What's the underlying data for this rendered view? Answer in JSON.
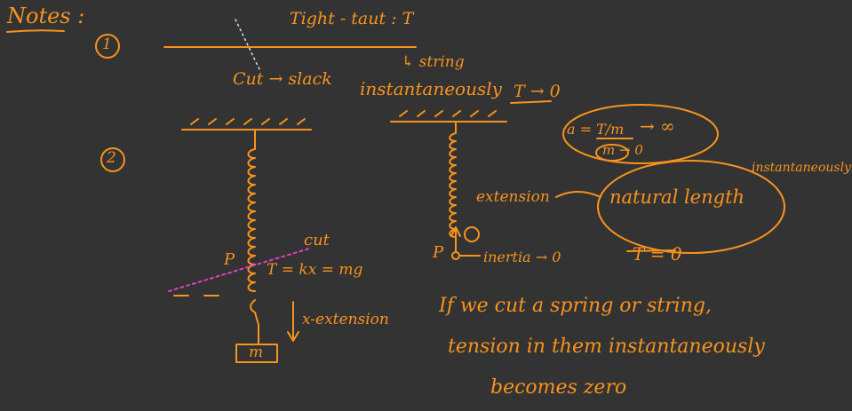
{
  "title": "Notes :",
  "markers": {
    "one": "1",
    "two": "2"
  },
  "part1": {
    "tight_taut": "Tight - taut : T",
    "cut_slack": "Cut → slack",
    "string": "↳ string",
    "instantaneously": "instantaneously",
    "t_to_zero": "T → 0"
  },
  "part2_left": {
    "cut": "cut",
    "point_p": "P",
    "tension_eq": "T = kx = mg",
    "x_extension": "x-extension",
    "mass": "m"
  },
  "part2_right": {
    "point_p": "P",
    "inertia": "inertia → 0",
    "extension": "extension",
    "natural_length": "natural length",
    "a_eq": "a = T/m",
    "to_infinity": "→ ∞",
    "m_to_zero": "m → 0",
    "instantaneously": "instantaneously",
    "t_eq_zero": "T = 0"
  },
  "conclusion": {
    "line1": "If we cut a spring or string,",
    "line2": "tension in them instantaneously",
    "line3": "becomes zero"
  },
  "colors": {
    "background": "#333333",
    "ink": "#F7931E",
    "cut_line": "#E040C0"
  }
}
